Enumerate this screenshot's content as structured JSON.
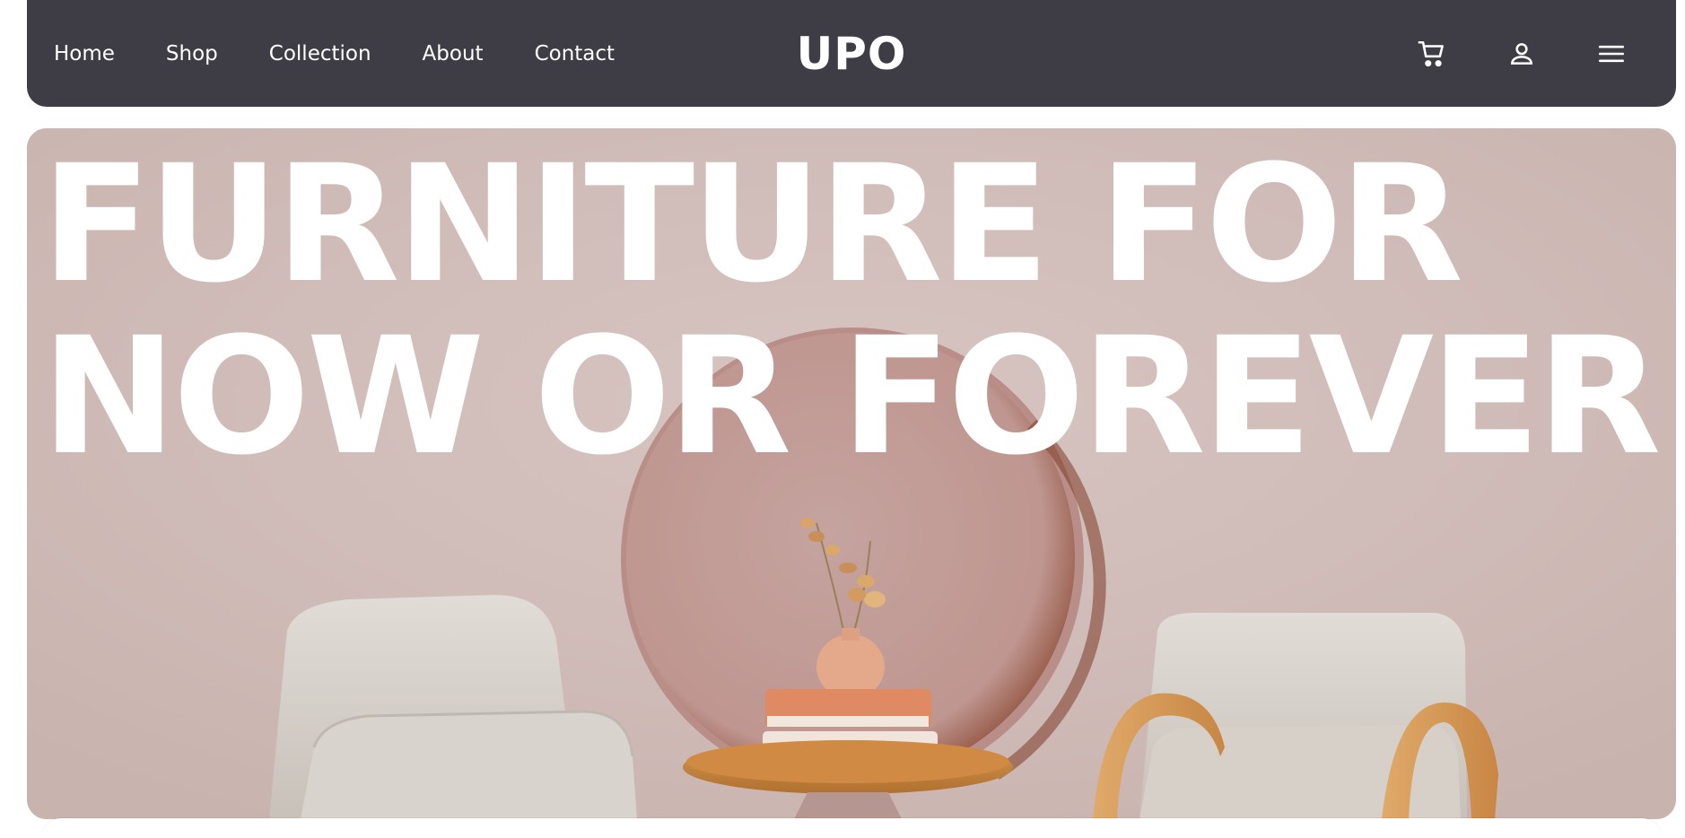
{
  "nav": {
    "links": [
      "Home",
      "Shop",
      "Collection",
      "About",
      "Contact"
    ],
    "brand": "UPO",
    "icons": [
      "cart-icon",
      "user-icon",
      "menu-icon"
    ]
  },
  "hero": {
    "headline_line1": "FURNITURE FOR",
    "headline_line2": "NOW OR FOREVER"
  },
  "colors": {
    "navbar_bg": "#3e3d46",
    "hero_bg": "#d3c0bd",
    "headline": "#ffffff"
  }
}
